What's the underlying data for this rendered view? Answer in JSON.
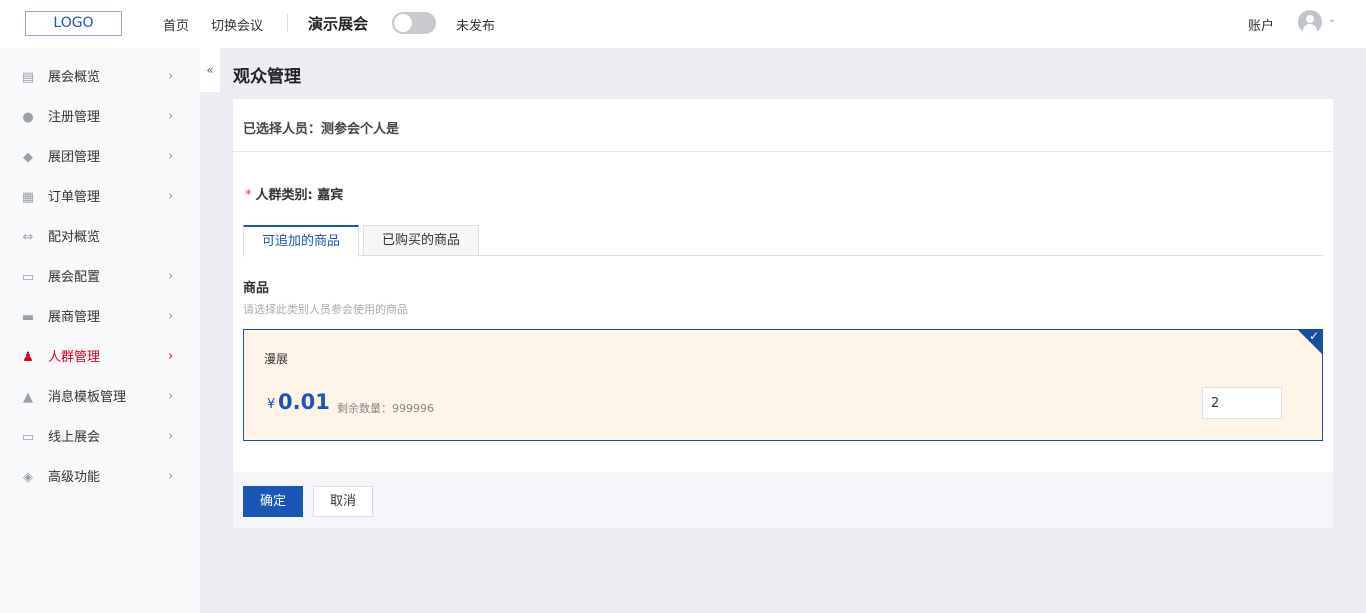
{
  "header": {
    "logo": "LOGO",
    "nav": [
      "首页",
      "切换会议"
    ],
    "expo_name": "演示展会",
    "publish_status": "未发布",
    "account": "账户"
  },
  "sidebar": {
    "collapse": "«",
    "items": [
      {
        "label": "展会概览",
        "icon": "book-icon",
        "glyph": "▤",
        "chevron": "›"
      },
      {
        "label": "注册管理",
        "icon": "user-plus-icon",
        "glyph": "●",
        "chevron": "›"
      },
      {
        "label": "展团管理",
        "icon": "group-icon",
        "glyph": "◆",
        "chevron": "›"
      },
      {
        "label": "订单管理",
        "icon": "order-icon",
        "glyph": "▦",
        "chevron": "›"
      },
      {
        "label": "配对概览",
        "icon": "swap-icon",
        "glyph": "⇔",
        "chevron": ""
      },
      {
        "label": "展会配置",
        "icon": "monitor-icon",
        "glyph": "▭",
        "chevron": "›"
      },
      {
        "label": "展商管理",
        "icon": "store-icon",
        "glyph": "▬",
        "chevron": "›"
      },
      {
        "label": "人群管理",
        "icon": "people-icon",
        "glyph": "♟",
        "chevron": "›",
        "active": true
      },
      {
        "label": "消息模板管理",
        "icon": "bell-icon",
        "glyph": "▲",
        "chevron": "›"
      },
      {
        "label": "线上展会",
        "icon": "display-icon",
        "glyph": "▭",
        "chevron": "›"
      },
      {
        "label": "高级功能",
        "icon": "tag-icon",
        "glyph": "◈",
        "chevron": "›"
      }
    ]
  },
  "main": {
    "title": "观众管理",
    "selected": "已选择人员：测参会个人是",
    "group_label": "人群类别: 嘉宾",
    "required_mark": "*",
    "tabs": [
      "可追加的商品",
      "已购买的商品"
    ],
    "goods_title": "商品",
    "goods_hint": "请选择此类别人员参会使用的商品",
    "product": {
      "name": "漫展",
      "currency": "¥",
      "price": "0.01",
      "stock": "剩余数量：999996",
      "quantity": "2",
      "check": "✓"
    },
    "confirm": "确定",
    "cancel": "取消"
  },
  "colors": {
    "accent": "#1a56b8",
    "active_menu": "#d9001b",
    "product_bg": "#fef5e8"
  }
}
